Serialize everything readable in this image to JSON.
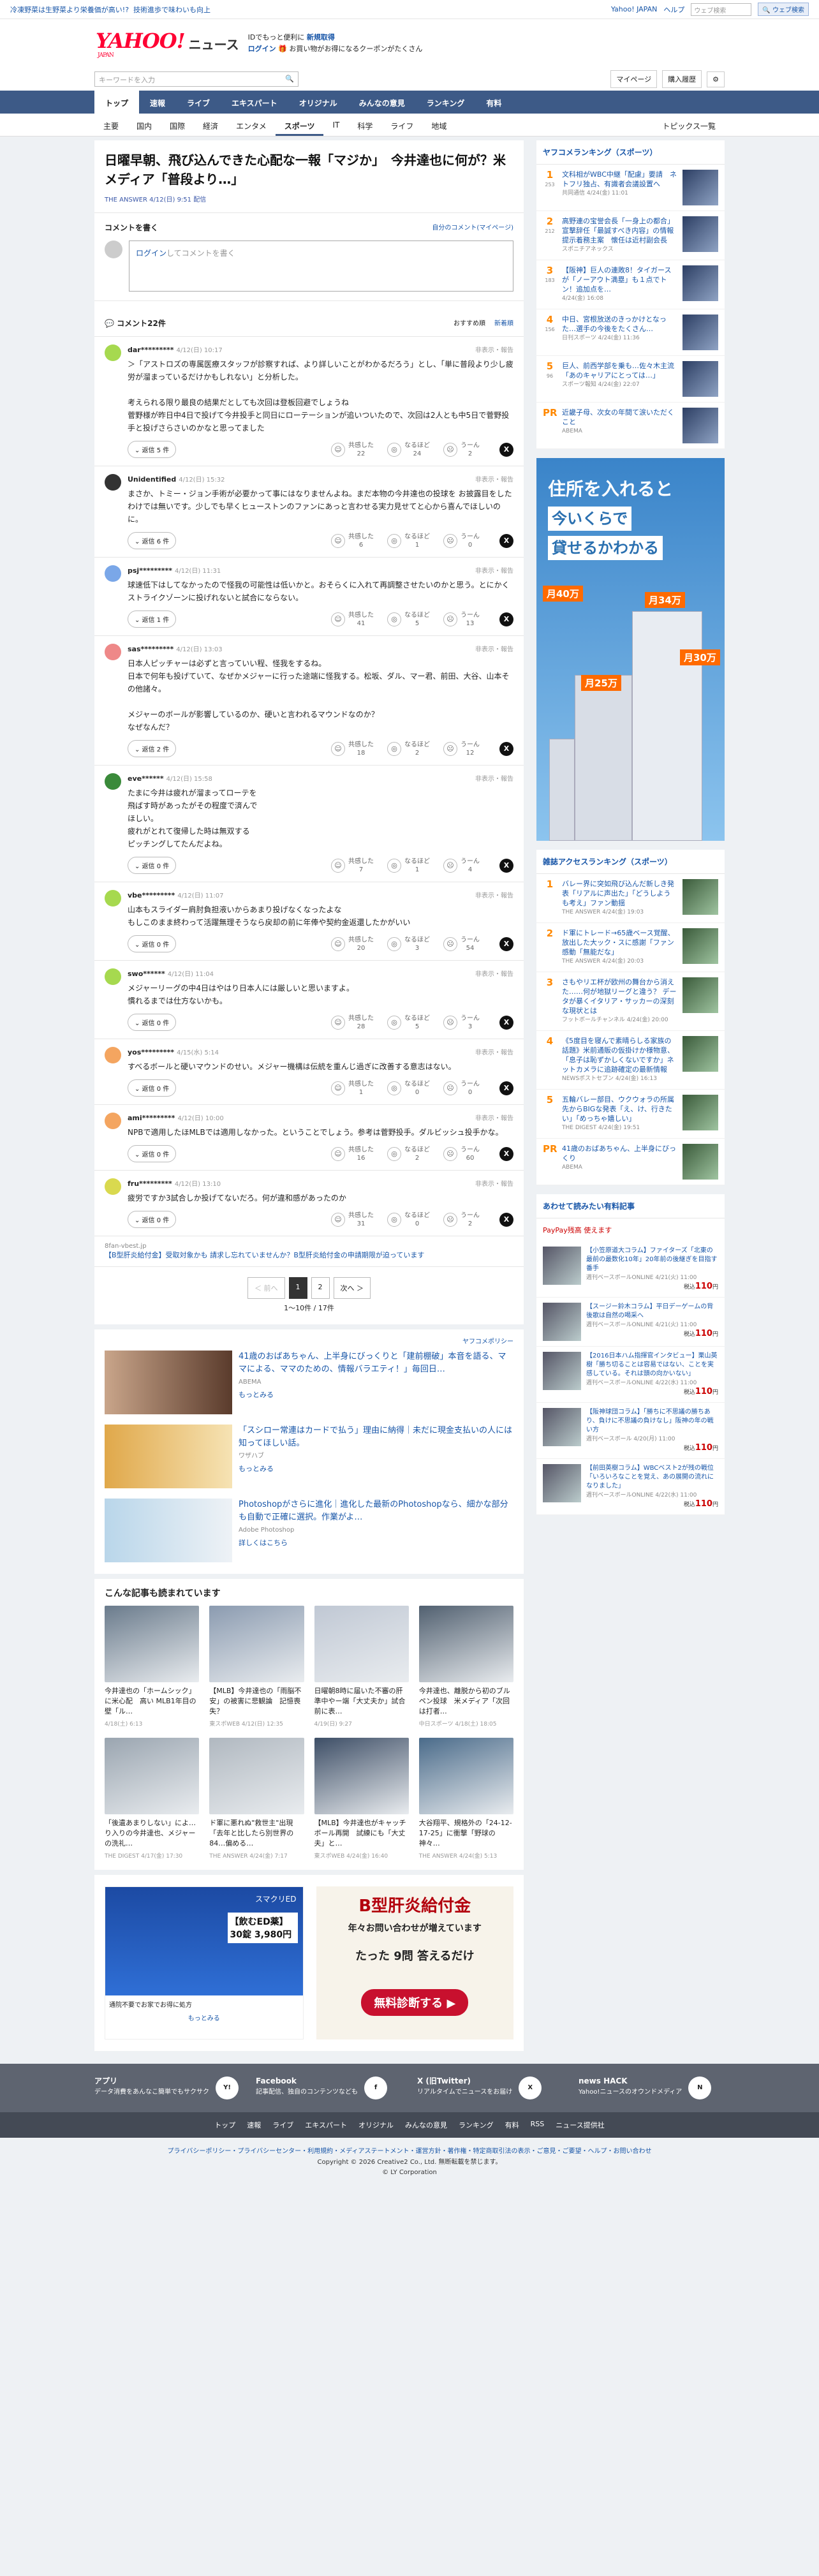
{
  "topbar": {
    "left1": "冷凍野菜は生野菜より栄養価が高い!?",
    "left2": "技術進歩で味わいも向上",
    "links": [
      "Yahoo! JAPAN",
      "ヘルプ"
    ],
    "search_placeholder": "ウェブ検索",
    "search_btn": "🔍 ウェブ検索"
  },
  "header": {
    "logo": "YAHOO!",
    "logo_sub": "JAPAN",
    "logo_news": "ニュース",
    "promo1": "IDでもっと便利に",
    "promo1b": "新規取得",
    "login": "ログイン",
    "promo2": "🎁 お買い物がお得になるクーポンがたくさん"
  },
  "tools": {
    "search_placeholder": "キーワードを入力",
    "mypage": "マイページ",
    "purchase": "購入履歴"
  },
  "catnav": [
    "トップ",
    "速報",
    "ライブ",
    "エキスパート",
    "オリジナル",
    "みんなの意見",
    "ランキング",
    "有料"
  ],
  "subnav": [
    "主要",
    "国内",
    "国際",
    "経済",
    "エンタメ",
    "スポーツ",
    "IT",
    "科学",
    "ライフ",
    "地域"
  ],
  "subnav_right": "トピックス一覧",
  "article": {
    "title": "日曜早朝、飛び込んできた心配な一報「マジか」　今井達也に何が？米メディア「普段より…」",
    "meta": "THE ANSWER 4/12(日) 9:51 配信"
  },
  "comment_box": {
    "title": "コメントを書く",
    "own": "自分のコメント(マイページ)",
    "login": "ログイン",
    "prompt": "してコメントを書く"
  },
  "comments_head": {
    "title": "コメント22件",
    "sort1": "おすすめ順",
    "sort2": "新着順"
  },
  "comments": [
    {
      "user": "dar*********",
      "date": "4/12(日) 10:17",
      "text": "＞「アストロズの専属医療スタッフが診察すれば、より詳しいことがわかるだろう」とし、「単に普段より少し疲労が溜まっているだけかもしれない」と分析した。\n\n考えられる限り最良の結果だとしても次回は登板回避でしょうね\n菅野様が昨日中4日で投げて今井投手と同日にローテーションが追いついたので、次回は2人とも中5日で菅野投手と投げさらさいのかなと思ってました",
      "reply": "返信 5 件",
      "r1": "22",
      "r2": "24",
      "r3": "2",
      "color": "#a6d94f"
    },
    {
      "user": "Unidentified",
      "date": "4/12(日) 15:32",
      "text": "まさか、トミー・ジョン手術が必要かって事にはなりませんよね。まだ本物の今井達也の投球を お披露目をしたわけでは無いです。少しでも早くヒューストンのファンにあっと言わせる実力見せてと心から喜んでほしいのに。",
      "reply": "返信 6 件",
      "r1": "6",
      "r2": "1",
      "r3": "0",
      "color": "#333"
    },
    {
      "user": "psj*********",
      "date": "4/12(日) 11:31",
      "text": "球速低下はしてなかったので怪我の可能性は低いかと。おそらくに入れて再調整させたいのかと思う。とにかくストライクゾーンに投げれないと試合にならない。",
      "reply": "返信 1 件",
      "r1": "41",
      "r2": "5",
      "r3": "13",
      "color": "#7aa7e8"
    },
    {
      "user": "sas*********",
      "date": "4/12(日) 13:03",
      "text": "日本人ピッチャーは必ずと言っていい程、怪我をするね。\n日本で何年も投げていて、なぜかメジャーに行った途端に怪我する。松坂、ダル、マー君、前田、大谷、山本その他諸々。\n\nメジャーのボールが影響しているのか、硬いと言われるマウンドなのか？\nなぜなんだ？",
      "reply": "返信 2 件",
      "r1": "18",
      "r2": "2",
      "r3": "12",
      "color": "#e88"
    },
    {
      "user": "eve******",
      "date": "4/12(日) 15:58",
      "text": "たまに今井は疲れが溜まってローテを\n飛ばす時があったがその程度で済んで\nほしい。\n疲れがとれて復帰した時は無双する\nピッチングしてたんだよね。",
      "reply": "返信 0 件",
      "r1": "7",
      "r2": "1",
      "r3": "4",
      "color": "#3a8a3a"
    },
    {
      "user": "vbe*********",
      "date": "4/12(日) 11:07",
      "text": "山本もスライダー肩肘負担液いからあまり投げなくなったよな\nもしこのまま終わって活躍無理そうなら戻却の前に年俸や契約金返還したかがいい",
      "reply": "返信 0 件",
      "r1": "20",
      "r2": "3",
      "r3": "54",
      "color": "#a6d94f"
    },
    {
      "user": "swo******",
      "date": "4/12(日) 11:04",
      "text": "メジャーリーグの中4日はやはり日本人には厳しいと思いますよ。\n慣れるまでは仕方ないかも。",
      "reply": "返信 0 件",
      "r1": "28",
      "r2": "5",
      "r3": "3",
      "color": "#a6d94f"
    },
    {
      "user": "yos*********",
      "date": "4/15(水) 5:14",
      "text": "すべるボールと硬いマウンドのせい。メジャー機構は伝統を重んじ過ぎに改善する意志はない。",
      "reply": "返信 0 件",
      "r1": "1",
      "r2": "0",
      "r3": "0",
      "color": "#f4a560"
    },
    {
      "user": "ami*********",
      "date": "4/12(日) 10:00",
      "text": "NPBで適用したほMLBでは適用しなかった。ということでしょう。参考は菅野投手。ダルビッシュ投手かな。",
      "reply": "返信 0 件",
      "r1": "16",
      "r2": "2",
      "r3": "60",
      "color": "#f4a560"
    },
    {
      "user": "fru*********",
      "date": "4/12(日) 13:10",
      "text": "疲労ですか3試合しか投げてないだろ。何が違和感があったのか",
      "reply": "返信 0 件",
      "r1": "31",
      "r2": "0",
      "r3": "2",
      "color": "#d9d94f"
    }
  ],
  "ad_line": {
    "src": "8fan-vbest.jp",
    "text": "【B型肝炎給付金】受取対象かも 請求し忘れていませんか？B型肝炎給付金の申請期限が迫っています"
  },
  "pager": {
    "prev": "＜ 前へ",
    "p1": "1",
    "p2": "2",
    "next": "次へ ＞",
    "info": "1〜10件 / 17件"
  },
  "ads": {
    "label": "ヤフコメポリシー",
    "items": [
      {
        "title": "41歳のおばあちゃん、上半身にびっくりと「建前棚破」本音を語る、ママによる、ママのための、情報バラエティ！」毎回日…",
        "src": "ABEMA",
        "link": "もっとみる"
      },
      {
        "title": "「スシロー常連はカードで払う」理由に納得｜未だに現金支払いの人には知ってほしい話。",
        "src": "ワザハブ",
        "link": "もっとみる"
      },
      {
        "title": "Photoshopがさらに進化｜進化した最新のPhotoshopなら、細かな部分も自動で正確に選択。作業がよ…",
        "src": "Adobe Photoshop",
        "link": "詳しくはこちら"
      }
    ]
  },
  "related": {
    "title": "こんな記事も読まれています",
    "items": [
      {
        "t": "今井達也の「ホームシック」に米心配　高い MLB1年目の壁「ル…",
        "s": "4/18(土) 6:13"
      },
      {
        "t": "【MLB】今井達也の「雨脳不安」の被害に悲観論　記憶喪失？",
        "s": "東スポWEB 4/12(日) 12:35"
      },
      {
        "t": "日曜朝8時に届いた不審の肝準中やー端「大丈夫か」試合前に表…",
        "s": "4/19(日) 9:27"
      },
      {
        "t": "今井達也、離脱から初のブルペン投球　米メディア「次回は打者…",
        "s": "中日スポーツ 4/18(土) 18:05"
      },
      {
        "t": "「後遺あまりしない」によ…り入りの今井達也、メジャーの洗礼…",
        "s": "THE DIGEST 4/17(金) 17:30"
      },
      {
        "t": "ド軍に悪れぬ\"救世主\"出現「去年と比したら別世界の84…偏める…",
        "s": "THE ANSWER 4/24(金) 7:17"
      },
      {
        "t": "【MLB】今井達也がキャッチボール再開　試練にも「大丈夫」と…",
        "s": "東スポWEB 4/24(金) 16:40"
      },
      {
        "t": "大谷翔平、規格外の「24-12-17-25」に衝撃「野球の神々…",
        "s": "THE ANSWER 4/24(金) 5:13"
      }
    ]
  },
  "bottom_ads": {
    "a1_title": "スマクリED",
    "a1_price": "【飲むED薬】30錠 3,980円",
    "a1_note": "通院不要でお家でお得に処方",
    "a1_link": "もっとみる",
    "a2_title": "B型肝炎給付金",
    "a2_text": "年々お問い合わせが増えています",
    "a2_q": "たった 9問 答えるだけ",
    "a2_cta": "無料診断する ▶"
  },
  "side_ranking": {
    "title": "ヤフコメランキング（スポーツ）",
    "items": [
      {
        "n": "1",
        "c": "253",
        "t": "文科相がWBC中継「配慮」要請　ネトフリ独占、有識者会議設置へ",
        "s": "共同通信 4/24(金) 11:01"
      },
      {
        "n": "2",
        "c": "212",
        "t": "高野連の宝誉会長「一身上の都合」宣撃辞任「最誠すべき内容」の情報提示着務主案　懐任は近村副会長",
        "s": "スポニチアネックス"
      },
      {
        "n": "3",
        "c": "183",
        "t": "【阪神】巨人の連敗8！タイガースが「ノーアウト満塁」も１点でトン！追加点を…",
        "s": "4/24(金) 16:08"
      },
      {
        "n": "4",
        "c": "156",
        "t": "中日、宮根放送のきっかけとなった…選手の今後をたくさん…",
        "s": "日刊スポーツ 4/24(金) 11:36"
      },
      {
        "n": "5",
        "c": "96",
        "t": "巨人、前西学部を乗も…佐々木主流「あのキャリアにとっては…」",
        "s": "スポーツ報知 4/24(金) 22:07"
      },
      {
        "n": "PR",
        "c": "",
        "t": "近畿子母、次女の年間て涙いただくこと",
        "s": "ABEMA"
      }
    ]
  },
  "bigad": {
    "l1": "住所を入れると",
    "l2": "今いくらで",
    "l3": "貸せるかわかる",
    "p1": "月40万",
    "p2": "月34万",
    "p3": "月25万",
    "p4": "月30万"
  },
  "side_access": {
    "title": "雑誌アクセスランキング（スポーツ）",
    "items": [
      {
        "n": "1",
        "t": "バレー界に突如飛び込んだ新しき発表「リアルに声出た」「どうしようも考え」ファン動揺",
        "s": "THE ANSWER 4/24(金) 19:03"
      },
      {
        "n": "2",
        "t": "ド軍にトレード→65歳ベース覚醒、放出した大ック・スに感謝「ファン感動「無能だな」",
        "s": "THE ANSWER 4/24(金) 20:03"
      },
      {
        "n": "3",
        "t": "さもやリエ杯が欧州の舞台から消えた……何が地獄リーグと違う？ データが暴くイタリア・サッカーの深刻な現状とは",
        "s": "フットボールチャンネル 4/24(金) 20:00"
      },
      {
        "n": "4",
        "t": "《5度目を寝んで素晴らしる家族の話題》米前通販の仮掛けか様物意、「息子は恥ずかしくないですか」ネットカメラに追跡確定の最新情報",
        "s": "NEWSポストセブン 4/24(金) 16:13"
      },
      {
        "n": "5",
        "t": "五輪バレー部目、ウクウォラの所属先からBIGな発表「え、け、行きたい」「めっちゃ嬉しい」",
        "s": "THE DIGEST 4/24(金) 19:51"
      },
      {
        "n": "PR",
        "t": "41歳のおばあちゃん、上半身にびっくり",
        "s": "ABEMA"
      }
    ]
  },
  "side_paid": {
    "title": "あわせて読みたい有料記事",
    "sub": "PayPay残高 使えます",
    "items": [
      {
        "t": "【小笠原道大コラム】ファイターズ「北東の最前の最数化10年」20年前の後継ぎを目指す番手",
        "s": "週刊ベースボールONLINE 4/21(火) 11:00",
        "p": "110"
      },
      {
        "t": "【スージー鈴木コラム】平日デーゲームの背後歌は自然の喝采へ",
        "s": "週刊ベースボールONLINE 4/21(火) 11:00",
        "p": "110"
      },
      {
        "t": "【2016日本ハム指揮官インタビュー】栗山英樹「勝ち切ることは容易ではない、ことを実感している。それは頭の向かいない」",
        "s": "週刊ベースボールONLINE 4/22(水) 11:00",
        "p": "110"
      },
      {
        "t": "【阪神球団コラム】「勝ちに不思議の勝ちあり、負けに不思議の負けなし」阪神の年の戦い方",
        "s": "週刊ベースボール 4/20(月) 11:00",
        "p": "110"
      },
      {
        "t": "【前田英樹コラム】WBCベスト2が残の戦位「いろいろなことを覚え、あの展開の流れになりました」",
        "s": "週刊ベースボールONLINE 4/22(水) 11:00",
        "p": "110"
      }
    ]
  },
  "footer": {
    "apps": [
      {
        "name": "アプリ",
        "desc": "データ消費をあんなこ簡単でもサクサク",
        "ic": "Y!"
      },
      {
        "name": "Facebook",
        "desc": "記事配信、独自のコンテンツなども",
        "ic": "f"
      },
      {
        "name": "X (旧Twitter)",
        "desc": "リアルタイムでニュースをお届け",
        "ic": "X"
      },
      {
        "name": "news HACK",
        "desc": "Yahoo!ニュースのオウンドメディア",
        "ic": "N"
      }
    ],
    "nav": [
      "トップ",
      "速報",
      "ライブ",
      "エキスパート",
      "オリジナル",
      "みんなの意見",
      "ランキング",
      "有料",
      "RSS",
      "ニュース提供社"
    ],
    "links": "プライバシーポリシー・プライバシーセンター・利用規約・メディアステートメント・運営方針・著作権・特定商取引法の表示・ご意見・ご要望・ヘルプ・お問い合わせ",
    "copy1": "Copyright © 2026 Creative2 Co., Ltd. 無断転載を禁じます。",
    "copy2": "© LY Corporation"
  }
}
